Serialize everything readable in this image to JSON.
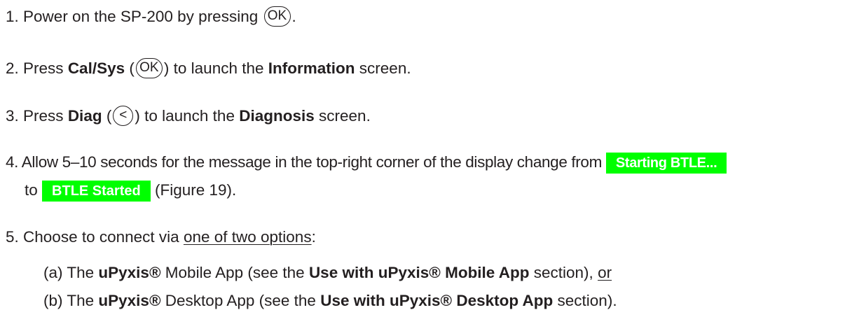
{
  "steps": [
    {
      "num": "1.",
      "text_a": "Power on the SP-200 by pressing",
      "button": "OK",
      "text_b": "."
    },
    {
      "num": "2.",
      "text_a": "Press",
      "bold_a": "Cal/Sys",
      "paren_open": "(",
      "button": "OK",
      "paren_close": ")",
      "text_b": "to launch the",
      "bold_b": "Information",
      "text_c": "screen."
    },
    {
      "num": "3.",
      "text_a": "Press",
      "bold_a": "Diag",
      "paren_open": "(",
      "button": "<",
      "paren_close": ")",
      "text_b": "to launch the",
      "bold_b": "Diagnosis",
      "text_c": "screen."
    },
    {
      "num": "4.",
      "text_a": "Allow 5–10 seconds for the message in the top-right corner of the display change from",
      "badge_a": "Starting BTLE...",
      "text_b": "to",
      "badge_b": "BTLE Started",
      "text_c": "(Figure 19)."
    },
    {
      "num": "5.",
      "text_a": "Choose to connect via",
      "underline": "one of two options",
      "text_b": ":"
    }
  ],
  "substeps": [
    {
      "label": "(a)",
      "text_a": "The",
      "bold_a": "uPyxis®",
      "text_b": "Mobile App (see the",
      "bold_b": "Use with uPyxis® Mobile App",
      "text_c": "section),",
      "underline": "or"
    },
    {
      "label": "(b)",
      "text_a": "The",
      "bold_a": "uPyxis®",
      "text_b": "Desktop App (see the",
      "bold_b": "Use with uPyxis® Desktop App",
      "text_c": "section)."
    }
  ]
}
